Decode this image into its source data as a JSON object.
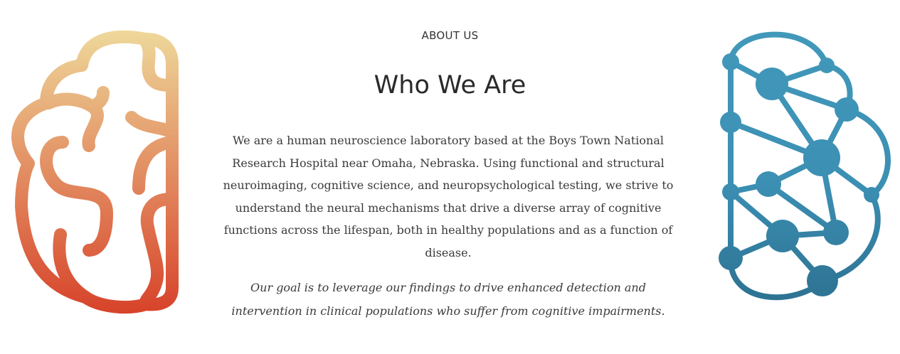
{
  "section": {
    "eyebrow": "ABOUT US",
    "title": "Who We Are",
    "description": "We are a human neuroscience laboratory based at the Boys Town National Research Hospital near Omaha, Nebraska. Using functional and structural neuroimaging, cognitive science, and neuropsychological testing, we strive to understand the neural mechanisms that drive a diverse array of cognitive functions across the lifespan, both in healthy populations and as a function of disease.",
    "goal": "Our goal is to leverage our findings to drive enhanced detection and intervention in clinical populations who suffer from cognitive impairments."
  },
  "colors": {
    "brain_left_top": "#eed99b",
    "brain_left_bottom": "#d7432a",
    "brain_right_top": "#4299bb",
    "brain_right_bottom": "#2c6f8e"
  }
}
